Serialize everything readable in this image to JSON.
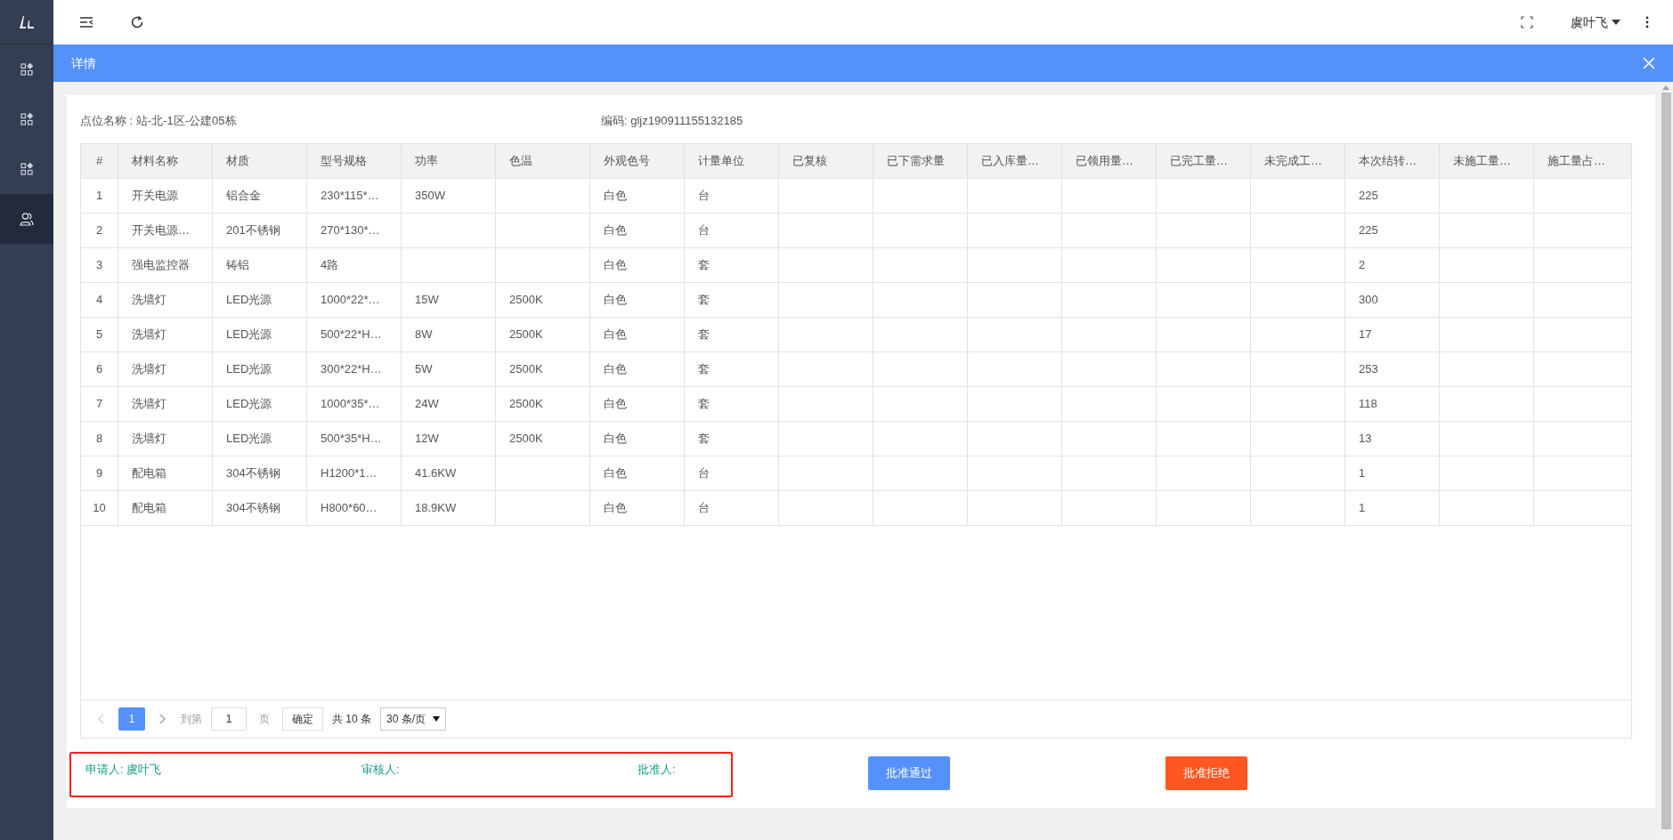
{
  "sidebar": {
    "items": [
      {
        "kind": "grid",
        "selected": false
      },
      {
        "kind": "grid",
        "selected": false
      },
      {
        "kind": "grid",
        "selected": false
      },
      {
        "kind": "user",
        "selected": true
      }
    ]
  },
  "topbar": {
    "user": "虞叶飞"
  },
  "panel": {
    "title": "详情"
  },
  "info": {
    "location": "点位名称 : 站-北-1区-公建05栋",
    "code": "编码: gljz190911155132185"
  },
  "table": {
    "columns": [
      "#",
      "材料名称",
      "材质",
      "型号规格",
      "功率",
      "色温",
      "外观色号",
      "计量单位",
      "已复核",
      "已下需求量",
      "已入库量…",
      "已领用量…",
      "已完工量…",
      "未完成工…",
      "本次结转…",
      "未施工量…",
      "施工量占…"
    ],
    "rows": [
      [
        "1",
        "开关电源",
        "铝合金",
        "230*115*…",
        "350W",
        "",
        "白色",
        "台",
        "",
        "",
        "",
        "",
        "",
        "",
        "225",
        "",
        ""
      ],
      [
        "2",
        "开关电源…",
        "201不锈钢",
        "270*130*…",
        "",
        "",
        "白色",
        "台",
        "",
        "",
        "",
        "",
        "",
        "",
        "225",
        "",
        ""
      ],
      [
        "3",
        "强电监控器",
        "铸铝",
        "4路",
        "",
        "",
        "白色",
        "套",
        "",
        "",
        "",
        "",
        "",
        "",
        "2",
        "",
        ""
      ],
      [
        "4",
        "洗墙灯",
        "LED光源",
        "1000*22*…",
        "15W",
        "2500K",
        "白色",
        "套",
        "",
        "",
        "",
        "",
        "",
        "",
        "300",
        "",
        ""
      ],
      [
        "5",
        "洗墙灯",
        "LED光源",
        "500*22*H…",
        "8W",
        "2500K",
        "白色",
        "套",
        "",
        "",
        "",
        "",
        "",
        "",
        "17",
        "",
        ""
      ],
      [
        "6",
        "洗墙灯",
        "LED光源",
        "300*22*H…",
        "5W",
        "2500K",
        "白色",
        "套",
        "",
        "",
        "",
        "",
        "",
        "",
        "253",
        "",
        ""
      ],
      [
        "7",
        "洗墙灯",
        "LED光源",
        "1000*35*…",
        "24W",
        "2500K",
        "白色",
        "套",
        "",
        "",
        "",
        "",
        "",
        "",
        "118",
        "",
        ""
      ],
      [
        "8",
        "洗墙灯",
        "LED光源",
        "500*35*H…",
        "12W",
        "2500K",
        "白色",
        "套",
        "",
        "",
        "",
        "",
        "",
        "",
        "13",
        "",
        ""
      ],
      [
        "9",
        "配电箱",
        "304不锈钢",
        "H1200*1…",
        "41.6KW",
        "",
        "白色",
        "台",
        "",
        "",
        "",
        "",
        "",
        "",
        "1",
        "",
        ""
      ],
      [
        "10",
        "配电箱",
        "304不锈钢",
        "H800*60…",
        "18.9KW",
        "",
        "白色",
        "台",
        "",
        "",
        "",
        "",
        "",
        "",
        "1",
        "",
        ""
      ]
    ]
  },
  "pagination": {
    "prev_disabled": true,
    "pages": [
      {
        "label": "1",
        "selected": true
      }
    ],
    "goto_label": "到第",
    "goto_value": "1",
    "page_suffix": "页",
    "confirm": "确定",
    "total": "共 10 条",
    "page_size": "30 条/页"
  },
  "signatures": {
    "highlighted": true,
    "items": [
      "申请人: 虞叶飞",
      "审核人:",
      "批准人:"
    ]
  },
  "actions": [
    {
      "label": "批准通过",
      "kind": "approve"
    },
    {
      "label": "批准拒绝",
      "kind": "reject"
    }
  ]
}
